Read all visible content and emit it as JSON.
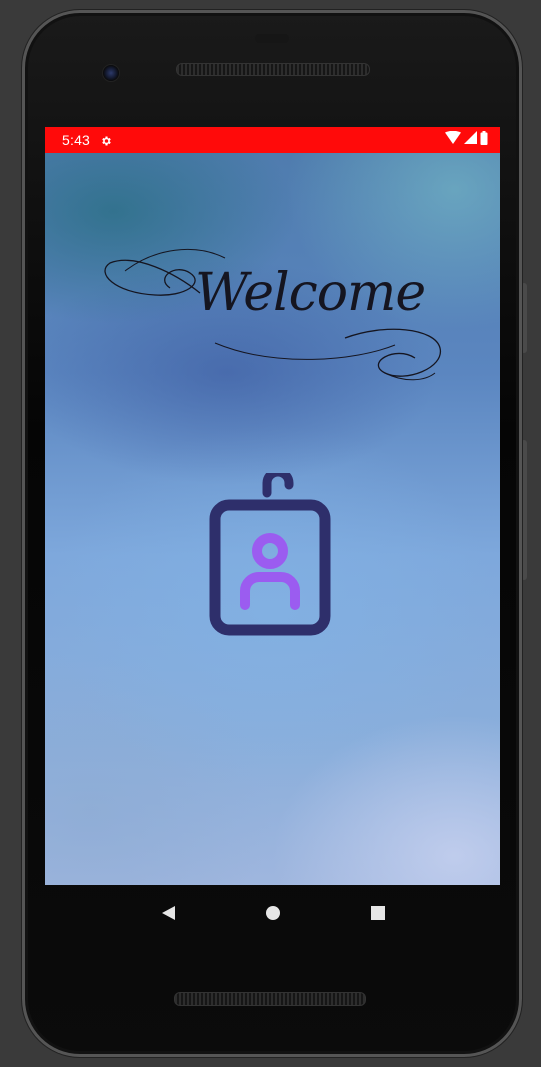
{
  "status_bar": {
    "time": "5:43",
    "color": "#ff0a0a",
    "icons": [
      "gear-icon",
      "wifi-icon",
      "signal-icon",
      "battery-icon"
    ]
  },
  "screen": {
    "welcome_text": "Welcome",
    "center_icon": "id-badge-icon",
    "badge_frame_color": "#2e2f6b",
    "badge_person_color": "#9b5cf0"
  },
  "nav_bar": {
    "buttons": [
      "back-icon",
      "home-icon",
      "recents-icon"
    ]
  }
}
